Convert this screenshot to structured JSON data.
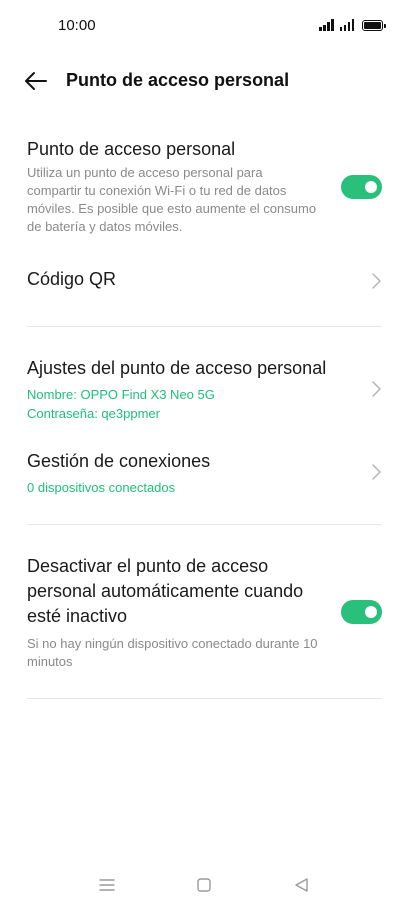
{
  "status_bar": {
    "time": "10:00"
  },
  "header": {
    "title": "Punto de acceso personal"
  },
  "hotspot": {
    "title": "Punto de acceso personal",
    "description": "Utiliza un punto de acceso personal para compartir tu conexión Wi-Fi o tu red de datos móviles. Es posible que esto aumente el consumo de batería y datos móviles.",
    "enabled": true
  },
  "qr_code": {
    "label": "Código QR"
  },
  "hotspot_settings": {
    "title": "Ajustes del punto de acceso personal",
    "name_line": "Nombre: OPPO Find X3 Neo 5G",
    "password_line": "Contraseña: qe3ppmer"
  },
  "connections": {
    "title": "Gestión de conexiones",
    "subtitle": "0 dispositivos conectados"
  },
  "auto_off": {
    "title": "Desactivar el punto de acceso personal automáticamente cuando esté inactivo",
    "description": "Si no hay ningún dispositivo conectado durante 10 minutos",
    "enabled": true
  },
  "colors": {
    "accent": "#28c07a",
    "link_green": "#1fbf7a",
    "secondary_text": "#8a8a8a"
  },
  "icons": [
    "back-arrow-icon",
    "chevron-right-icon",
    "menu-icon",
    "home-icon",
    "back-triangle-icon"
  ]
}
